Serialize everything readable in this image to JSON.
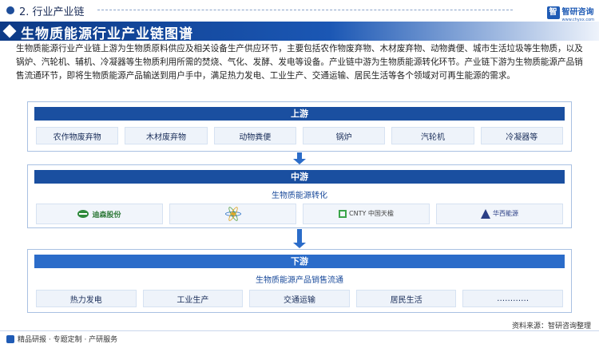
{
  "header": {
    "section": "2. 行业产业链",
    "brand_name": "智研咨询",
    "brand_sub": "www.chyxx.com"
  },
  "title": "生物质能源行业产业链图谱",
  "description": "生物质能源行业产业链上游为生物质原料供应及相关设备生产供应环节，主要包括农作物废弃物、木材废弃物、动物粪便、城市生活垃圾等生物质，以及锅炉、汽轮机、辅机、冷凝器等生物质利用所需的焚烧、气化、发酵、发电等设备。产业链中游为生物质能源转化环节。产业链下游为生物质能源产品销售流通环节，即将生物质能源产品输送到用户手中，满足热力发电、工业生产、交通运输、居民生活等各个领域对可再生能源的需求。",
  "upstream": {
    "label": "上游",
    "items": [
      "农作物废弃物",
      "木材废弃物",
      "动物粪便",
      "锅炉",
      "汽轮机",
      "冷凝器等"
    ]
  },
  "midstream": {
    "label": "中游",
    "subtitle": "生物质能源转化",
    "companies": [
      {
        "name": "迪森股份",
        "icon": "devotion-logo"
      },
      {
        "name": "",
        "icon": "atom-logo"
      },
      {
        "name": "CNTY 中国天楹",
        "icon": "cnty-logo"
      },
      {
        "name": "华西能源",
        "icon": "western-power-logo"
      }
    ]
  },
  "downstream": {
    "label": "下游",
    "subtitle": "生物质能源产品销售流通",
    "items": [
      "热力发电",
      "工业生产",
      "交通运输",
      "居民生活",
      "…………"
    ]
  },
  "footer": {
    "left": "精品研报 · 专题定制 · 产研服务",
    "source": "资料来源：智研咨询整理"
  }
}
